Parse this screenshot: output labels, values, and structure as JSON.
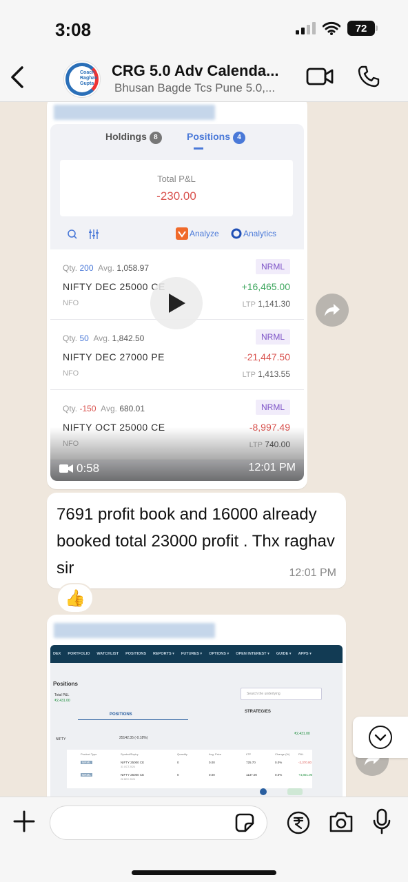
{
  "status_bar": {
    "time": "3:08",
    "battery": "72"
  },
  "header": {
    "title": "CRG 5.0 Adv Calenda...",
    "subtitle": "Bhusan Bagde Tcs Pune 5.0,...",
    "avatar_logo_text": "Coach Raghav Gupta"
  },
  "video_message": {
    "app_tabs": {
      "holdings_label": "Holdings",
      "holdings_count": "8",
      "positions_label": "Positions",
      "positions_count": "4"
    },
    "total_pl_label": "Total P&L",
    "total_pl_value": "-230.00",
    "analyze_label": "Analyze",
    "analytics_label": "Analytics",
    "positions": [
      {
        "qty_label": "Qty.",
        "qty": "200",
        "avg_label": "Avg.",
        "avg": "1,058.97",
        "product": "NRML",
        "name": "NIFTY DEC 25000 CE",
        "pnl": "+16,465.00",
        "pnl_color": "#3ba55c",
        "exchange": "NFO",
        "ltp_label": "LTP",
        "ltp": "1,141.30"
      },
      {
        "qty_label": "Qty.",
        "qty": "50",
        "avg_label": "Avg.",
        "avg": "1,842.50",
        "product": "NRML",
        "name": "NIFTY DEC 27000 PE",
        "pnl": "-21,447.50",
        "pnl_color": "#d9534f",
        "exchange": "NFO",
        "ltp_label": "LTP",
        "ltp": "1,413.55"
      },
      {
        "qty_label": "Qty.",
        "qty": "-150",
        "avg_label": "Avg.",
        "avg": "680.01",
        "product": "NRML",
        "name": "NIFTY OCT 25000 CE",
        "pnl": "-8,997.49",
        "pnl_color": "#d9534f",
        "exchange": "NFO",
        "ltp_label": "LTP",
        "ltp": "740.00"
      }
    ],
    "duration": "0:58",
    "time": "12:01 PM"
  },
  "text_message": {
    "text": "7691 profit book and 16000 already booked total 23000 profit . Thx  raghav sir",
    "time": "12:01 PM",
    "reaction": "👍"
  },
  "image_message": {
    "nav_items": [
      "DEX",
      "PORTFOLIO",
      "WATCHLIST",
      "POSITIONS",
      "REPORTS ▾",
      "FUTURES ▾",
      "OPTIONS ▾",
      "OPEN INTEREST ▾",
      "GUIDE ▾",
      "APPS ▾"
    ],
    "page_title": "Positions",
    "total_pl_label": "Total P&L",
    "total_pl_value": "₹2,431.00",
    "search_placeholder": "Search the underlying",
    "tab_positions": "POSITIONS",
    "tab_strategies": "STRATEGIES",
    "underlying": "NIFTY",
    "underlying_price": "25142.35 (-0.18%)",
    "underlying_pl": "₹2,431.00",
    "columns": [
      "Product Type",
      "Symbol/Expiry",
      "Quantity",
      "Avg. Price",
      "LTP",
      "Change (%)",
      "P&L"
    ],
    "rows": [
      {
        "product": "NRML",
        "symbol": "NIFTY 25000 CE",
        "expiry": "31 OCT 2024",
        "qty": "0",
        "avg": "0.00",
        "ltp": "725.70",
        "change": "0.0%",
        "pnl": "-2,370.00"
      },
      {
        "product": "NRML",
        "symbol": "NIFTY 25000 CE",
        "expiry": "26 DEC 2024",
        "qty": "0",
        "avg": "0.00",
        "ltp": "1137.00",
        "change": "0.0%",
        "pnl": "+4,801.00"
      }
    ]
  },
  "input": {
    "placeholder": ""
  },
  "colors": {
    "chat_bg": "#efe7dd",
    "bubble": "#ffffff",
    "accent": "#4a79d8",
    "loss": "#d9534f",
    "profit": "#3ba55c"
  }
}
